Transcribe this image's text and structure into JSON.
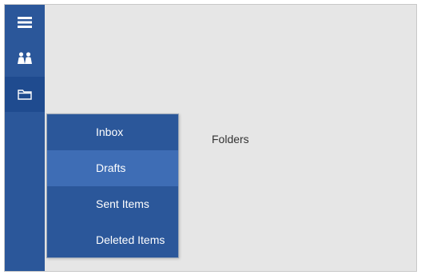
{
  "colors": {
    "nav_background": "#2b579a",
    "nav_selected": "#1f4b8f",
    "flyout_selected": "#3e6db5",
    "content_background": "#e6e6e6"
  },
  "nav": {
    "items": [
      {
        "icon": "hamburger-menu-icon"
      },
      {
        "icon": "people-icon"
      },
      {
        "icon": "folder-icon",
        "selected": true
      }
    ]
  },
  "content": {
    "label": "Folders"
  },
  "flyout": {
    "items": [
      {
        "label": "Inbox"
      },
      {
        "label": "Drafts",
        "selected": true
      },
      {
        "label": "Sent Items"
      },
      {
        "label": "Deleted Items"
      }
    ]
  }
}
